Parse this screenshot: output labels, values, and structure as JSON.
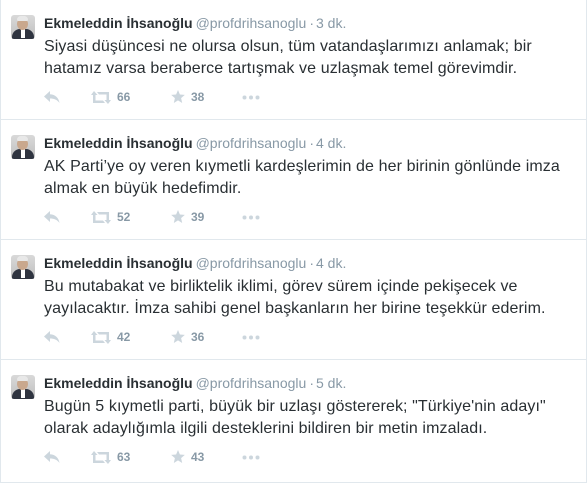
{
  "tweets": [
    {
      "fullname": "Ekmeleddin İhsanoğlu",
      "username": "@profdrihsanoglu",
      "separator": "·",
      "time": "3 dk.",
      "text": "Siyasi düşüncesi ne olursa olsun, tüm vatandaşlarımızı anlamak; bir hatamız varsa beraberce tartışmak ve uzlaşmak temel görevimdir.",
      "retweets": "66",
      "favorites": "38"
    },
    {
      "fullname": "Ekmeleddin İhsanoğlu",
      "username": "@profdrihsanoglu",
      "separator": "·",
      "time": "4 dk.",
      "text": "AK Parti’ye oy veren kıymetli kardeşlerimin de her birinin gönlünde imza almak en büyük hedefimdir.",
      "retweets": "52",
      "favorites": "39"
    },
    {
      "fullname": "Ekmeleddin İhsanoğlu",
      "username": "@profdrihsanoglu",
      "separator": "·",
      "time": "4 dk.",
      "text": "Bu mutabakat ve birliktelik iklimi, görev sürem içinde pekişecek ve yayılacaktır. İmza sahibi genel başkanların her birine teşekkür ederim.",
      "retweets": "42",
      "favorites": "36"
    },
    {
      "fullname": "Ekmeleddin İhsanoğlu",
      "username": "@profdrihsanoglu",
      "separator": "·",
      "time": "5 dk.",
      "text": "Bugün 5 kıymetli parti, büyük bir uzlaşı göstererek; \"Türkiye'nin adayı\" olarak adaylığımla ilgili desteklerini bildiren bir metin imzaladı.",
      "retweets": "63",
      "favorites": "43"
    }
  ],
  "icons": {
    "reply": "reply-icon",
    "retweet": "retweet-icon",
    "favorite": "star-icon",
    "more": "more-dots-icon"
  },
  "colors": {
    "name": "#292f33",
    "meta": "#8899a6",
    "icon": "#ccd6dd",
    "divider": "#e1e8ed"
  }
}
